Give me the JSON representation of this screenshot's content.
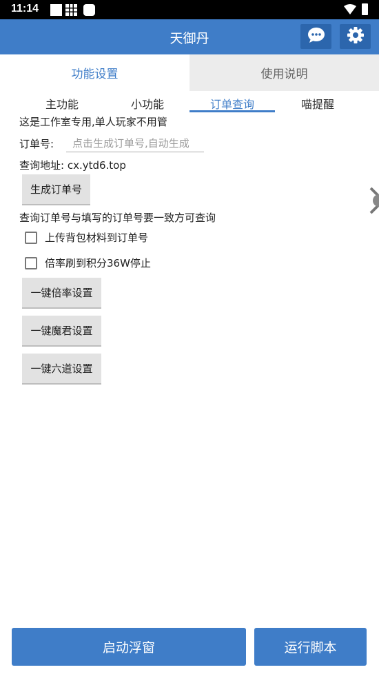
{
  "status_bar": {
    "time": "11:14"
  },
  "app_bar": {
    "title": "天御丹"
  },
  "main_tabs": [
    {
      "label": "功能设置",
      "active": true
    },
    {
      "label": "使用说明",
      "active": false
    }
  ],
  "sub_tabs": [
    {
      "label": "主功能"
    },
    {
      "label": "小功能"
    },
    {
      "label": "订单查询",
      "active": true
    },
    {
      "label": "喵提醒"
    }
  ],
  "content": {
    "notice": "这是工作室专用,单人玩家不用管",
    "order_label": "订单号:",
    "order_input": {
      "value": "",
      "placeholder": "点击生成订单号,自动生成"
    },
    "query_address": "查询地址: cx.ytd6.top",
    "generate_button": "生成订单号",
    "query_hint": "查询订单号与填写的订单号要一致方可查询",
    "checkbox_upload": {
      "label": "上传背包材料到订单号",
      "checked": false
    },
    "checkbox_stop": {
      "label": "倍率刷到积分36W停止",
      "checked": false
    },
    "buttons": {
      "rate": "一键倍率设置",
      "demon": "一键魔君设置",
      "six_paths": "一键六道设置"
    }
  },
  "bottom": {
    "start_float": "启动浮窗",
    "run_script": "运行脚本"
  },
  "colors": {
    "accent": "#3f7dc8",
    "accent_dark": "#2c66ad",
    "tab_inactive_bg": "#ececec",
    "button_gray": "#e2e2e2"
  }
}
